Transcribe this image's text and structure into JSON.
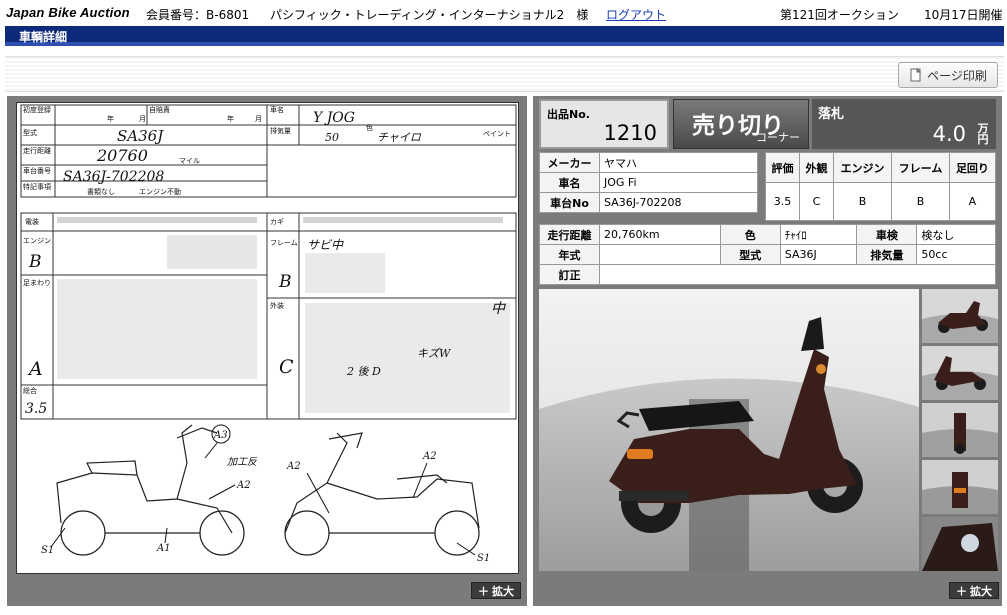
{
  "header": {
    "logo": "Japan Bike Auction",
    "member_no": "会員番号：B-6801",
    "customer": "パシフィック・トレーディング・インターナショナル2　様",
    "logout": "ログアウト",
    "auction": "第121回オークション",
    "date": "10月17日開催"
  },
  "title": "車輌詳細",
  "toolbar": {
    "print": "ページ印刷"
  },
  "sheet": {
    "labels": {
      "first_reg": "初度登録",
      "year": "年",
      "month": "月",
      "inspection": "自賠責",
      "model_name": "車名",
      "type": "型式",
      "displacement": "排気量",
      "color": "色",
      "paint": "ペイント",
      "mileage": "走行距離",
      "miles": "マイル",
      "frame_no": "車台番号",
      "notes": "特記事項",
      "docs": "書類なし",
      "engine_stop": "エンジン不動",
      "electric": "電装",
      "engine": "エンジン",
      "legs": "足まわり",
      "total": "総合",
      "frame": "フレーム",
      "exterior": "外装",
      "key": "カギ"
    },
    "handwritten": {
      "model": "Y JOG",
      "type": "SA36J",
      "cc": "50",
      "color": "チャイロ",
      "mileage": "20760",
      "frame": "SA36J-702208",
      "engine_grade": "B",
      "frame_grade": "B",
      "legs_grade": "A",
      "exterior_grade": "C",
      "total": "3.5",
      "frame_note": "サビ中",
      "ext_note1": "中",
      "ext_note2": "キズW",
      "ext_note3": "2 後 D",
      "a3": "A3",
      "a2_left": "A2",
      "a1": "A1",
      "s1_left": "S1",
      "kako": "加工反",
      "a2_right1": "A2",
      "a2_right2": "A2",
      "s1_right": "S1"
    },
    "expand": "拡大"
  },
  "lot": {
    "label": "出品No.",
    "value": "1210"
  },
  "sold": {
    "main": "売り切り",
    "sub": "コーナー"
  },
  "price": {
    "label": "落札",
    "value": "4.0",
    "unit": "万円"
  },
  "specs": [
    {
      "label": "メーカー",
      "value": "ヤマハ"
    },
    {
      "label": "車名",
      "value": "JOG Fi"
    },
    {
      "label": "車台No",
      "value": "SA36J-702208"
    }
  ],
  "grades": {
    "headers": [
      "評価",
      "外観",
      "エンジン",
      "フレーム",
      "足回り"
    ],
    "values": [
      "3.5",
      "C",
      "B",
      "B",
      "A"
    ]
  },
  "details": {
    "mileage_label": "走行距離",
    "mileage": "20,760km",
    "color_label": "色",
    "color": "ﾁｬｲﾛ",
    "inspection_label": "車検",
    "inspection": "検なし",
    "year_label": "年式",
    "year": "",
    "type_label": "型式",
    "type": "SA36J",
    "cc_label": "排気量",
    "cc": "50cc",
    "correction_label": "訂正",
    "correction": ""
  },
  "photos": {
    "expand": "拡大"
  },
  "colors": {
    "navy": "#0d2a7a",
    "panel_gray": "#7b7b7b",
    "scooter_body": "#3a1e1a"
  }
}
